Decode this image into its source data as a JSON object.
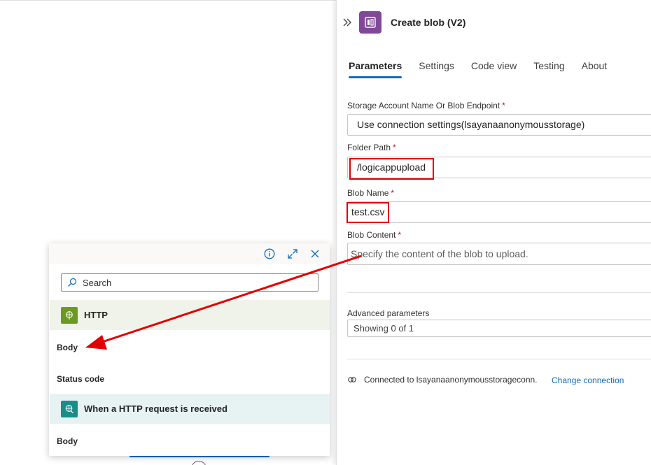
{
  "panel": {
    "title": "Create blob (V2)",
    "connector_icon": "storage-blob-icon",
    "tabs": [
      {
        "label": "Parameters",
        "active": true
      },
      {
        "label": "Settings",
        "active": false
      },
      {
        "label": "Code view",
        "active": false
      },
      {
        "label": "Testing",
        "active": false
      },
      {
        "label": "About",
        "active": false
      }
    ],
    "fields": {
      "storage_account": {
        "label": "Storage Account Name Or Blob Endpoint",
        "required": "*",
        "value": "Use connection settings(lsayanaanonymousstorage)"
      },
      "folder_path": {
        "label": "Folder Path",
        "required": "*",
        "value": "/logicappupload"
      },
      "blob_name": {
        "label": "Blob Name",
        "required": "*",
        "value": "test.csv"
      },
      "blob_content": {
        "label": "Blob Content",
        "required": "*",
        "placeholder": "Specify the content of the blob to upload."
      }
    },
    "advanced": {
      "label": "Advanced parameters",
      "value": "Showing 0 of 1"
    },
    "connection": {
      "text": "Connected to lsayanaanonymousstorageconn.",
      "change_link": "Change connection"
    }
  },
  "popup": {
    "search_placeholder": "Search",
    "groups": [
      {
        "name": "HTTP",
        "tokens": [
          "Body",
          "Status code"
        ],
        "color": "#6b9a24"
      },
      {
        "name": "When a HTTP request is received",
        "tokens": [
          "Body"
        ],
        "color": "#178e8c"
      }
    ]
  },
  "colors": {
    "accent": "#0f6cbd",
    "highlight": "#e00000",
    "connector": "#804998"
  }
}
